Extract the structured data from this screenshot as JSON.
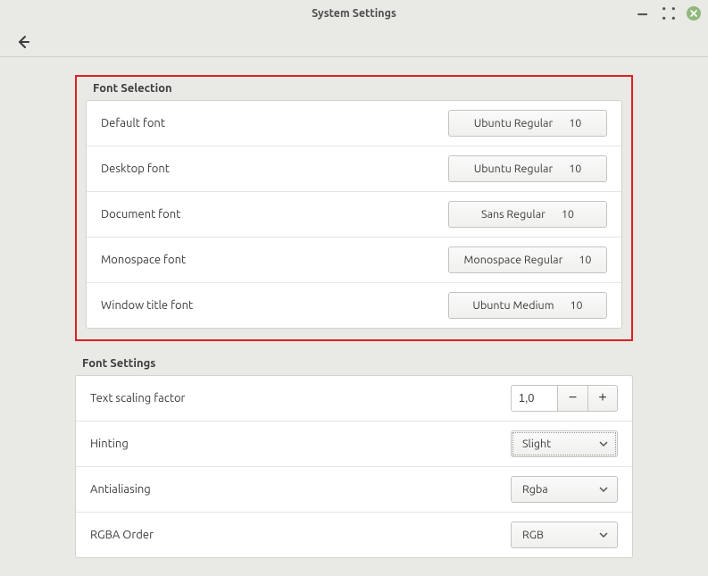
{
  "window": {
    "title": "System Settings"
  },
  "sections": {
    "fontSelection": {
      "title": "Font Selection",
      "rows": [
        {
          "label": "Default font",
          "fontName": "Ubuntu Regular",
          "fontSize": "10"
        },
        {
          "label": "Desktop font",
          "fontName": "Ubuntu Regular",
          "fontSize": "10"
        },
        {
          "label": "Document font",
          "fontName": "Sans Regular",
          "fontSize": "10"
        },
        {
          "label": "Monospace font",
          "fontName": "Monospace Regular",
          "fontSize": "10"
        },
        {
          "label": "Window title font",
          "fontName": "Ubuntu Medium",
          "fontSize": "10"
        }
      ]
    },
    "fontSettings": {
      "title": "Font Settings",
      "scaling": {
        "label": "Text scaling factor",
        "value": "1,0"
      },
      "hinting": {
        "label": "Hinting",
        "value": "Slight"
      },
      "antialias": {
        "label": "Antialiasing",
        "value": "Rgba"
      },
      "rgba": {
        "label": "RGBA Order",
        "value": "RGB"
      }
    }
  }
}
